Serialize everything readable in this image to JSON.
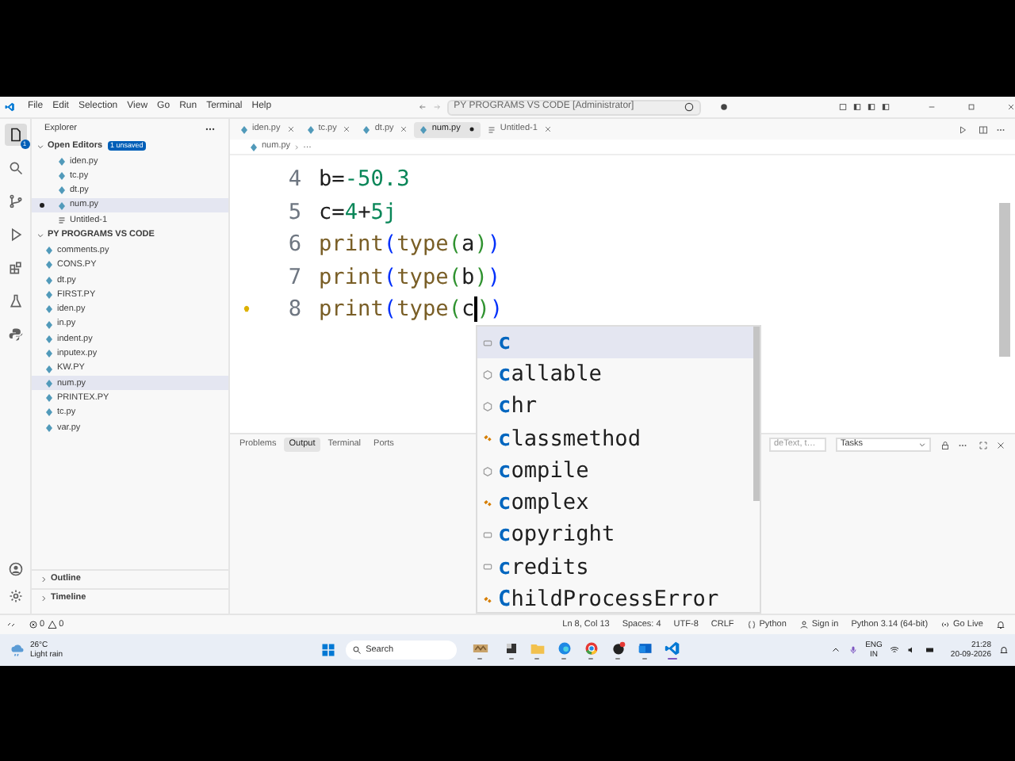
{
  "title_bar": {
    "menu": [
      "File",
      "Edit",
      "Selection",
      "View",
      "Go",
      "Run",
      "Terminal",
      "Help"
    ],
    "command_center": "PY PROGRAMS VS CODE [Administrator]"
  },
  "activity_bar": {
    "badge": "1",
    "items": [
      {
        "kind": "files",
        "selected": true
      },
      {
        "kind": "search",
        "selected": false
      },
      {
        "kind": "source-control",
        "selected": false
      },
      {
        "kind": "run",
        "selected": false
      },
      {
        "kind": "extensions",
        "selected": false
      },
      {
        "kind": "testing",
        "selected": false
      },
      {
        "kind": "python",
        "selected": false
      }
    ]
  },
  "sidebar": {
    "title": "Explorer",
    "open_editors": {
      "label": "Open Editors",
      "badge": "1 unsaved",
      "expanded": true,
      "items": [
        {
          "name": "iden.py",
          "kind": "python",
          "dirty": false,
          "selected": false
        },
        {
          "name": "tc.py",
          "kind": "python",
          "dirty": false,
          "selected": false
        },
        {
          "name": "dt.py",
          "kind": "python",
          "dirty": false,
          "selected": false
        },
        {
          "name": "num.py",
          "kind": "python",
          "dirty": true,
          "selected": true
        },
        {
          "name": "Untitled-1",
          "kind": "text",
          "dirty": false,
          "selected": false
        }
      ]
    },
    "folder": {
      "label": "PY PROGRAMS VS CODE",
      "expanded": true,
      "items": [
        {
          "name": "comments.py",
          "selected": false
        },
        {
          "name": "CONS.PY",
          "selected": false
        },
        {
          "name": "dt.py",
          "selected": false
        },
        {
          "name": "FIRST.PY",
          "selected": false
        },
        {
          "name": "iden.py",
          "selected": false
        },
        {
          "name": "in.py",
          "selected": false
        },
        {
          "name": "indent.py",
          "selected": false
        },
        {
          "name": "inputex.py",
          "selected": false
        },
        {
          "name": "KW.PY",
          "selected": false
        },
        {
          "name": "num.py",
          "selected": true
        },
        {
          "name": "PRINTEX.PY",
          "selected": false
        },
        {
          "name": "tc.py",
          "selected": false
        },
        {
          "name": "var.py",
          "selected": false
        }
      ]
    },
    "sections": [
      {
        "label": "Outline",
        "expanded": false
      },
      {
        "label": "Timeline",
        "expanded": false
      }
    ]
  },
  "tabs": [
    {
      "label": "iden.py",
      "kind": "python",
      "selected": false,
      "dirty": false
    },
    {
      "label": "tc.py",
      "kind": "python",
      "selected": false,
      "dirty": false
    },
    {
      "label": "dt.py",
      "kind": "python",
      "selected": false,
      "dirty": false
    },
    {
      "label": "num.py",
      "kind": "python",
      "selected": true,
      "dirty": true
    },
    {
      "label": "Untitled-1",
      "kind": "text",
      "selected": false,
      "dirty": false
    }
  ],
  "breadcrumb": [
    "num.py",
    "…"
  ],
  "editor": {
    "lines": [
      {
        "number": "4",
        "tokens": [
          {
            "text": "b=",
            "kind": "plain"
          },
          {
            "text": "-50.3",
            "kind": "number"
          }
        ]
      },
      {
        "number": "5",
        "tokens": [
          {
            "text": "c=",
            "kind": "plain"
          },
          {
            "text": "4",
            "kind": "number"
          },
          {
            "text": "+",
            "kind": "plain"
          },
          {
            "text": "5j",
            "kind": "number"
          }
        ]
      },
      {
        "number": "6",
        "tokens": [
          {
            "text": "print",
            "kind": "function"
          },
          {
            "text": "(",
            "kind": "bracket1"
          },
          {
            "text": "type",
            "kind": "function"
          },
          {
            "text": "(",
            "kind": "bracket2"
          },
          {
            "text": "a",
            "kind": "plain"
          },
          {
            "text": ")",
            "kind": "bracket2"
          },
          {
            "text": ")",
            "kind": "bracket1"
          }
        ]
      },
      {
        "number": "7",
        "tokens": [
          {
            "text": "print",
            "kind": "function"
          },
          {
            "text": "(",
            "kind": "bracket1"
          },
          {
            "text": "type",
            "kind": "function"
          },
          {
            "text": "(",
            "kind": "bracket2"
          },
          {
            "text": "b",
            "kind": "plain"
          },
          {
            "text": ")",
            "kind": "bracket2"
          },
          {
            "text": ")",
            "kind": "bracket1"
          }
        ]
      },
      {
        "number": "8",
        "lightbulb": true,
        "tokens": [
          {
            "text": "print",
            "kind": "function"
          },
          {
            "text": "(",
            "kind": "bracket1"
          },
          {
            "text": "type",
            "kind": "function"
          },
          {
            "text": "(",
            "kind": "bracket2"
          },
          {
            "text": "c",
            "kind": "plain",
            "caret_after": true
          },
          {
            "text": ")",
            "kind": "bracket2"
          },
          {
            "text": ")",
            "kind": "bracket1"
          }
        ]
      }
    ]
  },
  "suggestions": [
    {
      "label": "**c**",
      "kind": "variable",
      "selected": true
    },
    {
      "label": "**c**allable",
      "kind": "function",
      "selected": false
    },
    {
      "label": "**c**hr",
      "kind": "function",
      "selected": false
    },
    {
      "label": "**c**lassmethod",
      "kind": "class",
      "selected": false
    },
    {
      "label": "**c**ompile",
      "kind": "function",
      "selected": false
    },
    {
      "label": "**c**omplex",
      "kind": "class",
      "selected": false
    },
    {
      "label": "**c**opyright",
      "kind": "variable",
      "selected": false
    },
    {
      "label": "**c**redits",
      "kind": "variable",
      "selected": false
    },
    {
      "label": "**C**hildProcessError",
      "kind": "class",
      "selected": false
    }
  ],
  "panel": {
    "tabs": [
      {
        "label": "Problems",
        "selected": false
      },
      {
        "label": "Output",
        "selected": true
      },
      {
        "label": "Terminal",
        "selected": false
      },
      {
        "label": "Ports",
        "selected": false
      }
    ],
    "filter": "deText, t…",
    "dropdown": "Tasks"
  },
  "status_bar": {
    "errors": "0",
    "warnings": "0",
    "items": [
      {
        "text": "Ln 8, Col 13",
        "kind": "position"
      },
      {
        "text": "Spaces: 4",
        "kind": "indent"
      },
      {
        "text": "UTF-8",
        "kind": "encoding"
      },
      {
        "text": "CRLF",
        "kind": "eol"
      },
      {
        "text": "Python",
        "kind": "language"
      },
      {
        "text": "Sign in",
        "kind": "account"
      },
      {
        "text": "Python 3.14 (64-bit)",
        "kind": "interpreter"
      },
      {
        "text": "Go Live",
        "kind": "live"
      }
    ]
  },
  "taskbar": {
    "temperature": "26°C",
    "weather": "Light rain",
    "search": "Search",
    "apps": [
      {
        "kind": "photo",
        "active": false
      },
      {
        "kind": "task-view",
        "active": false
      },
      {
        "kind": "folder",
        "active": false
      },
      {
        "kind": "edge",
        "active": false
      },
      {
        "kind": "chrome",
        "active": false
      },
      {
        "kind": "chat",
        "active": false
      },
      {
        "kind": "mail",
        "active": false
      },
      {
        "kind": "code",
        "active": true
      }
    ],
    "language": "ENG",
    "region": "IN",
    "time": "21:28",
    "date": "20-09-2026"
  }
}
